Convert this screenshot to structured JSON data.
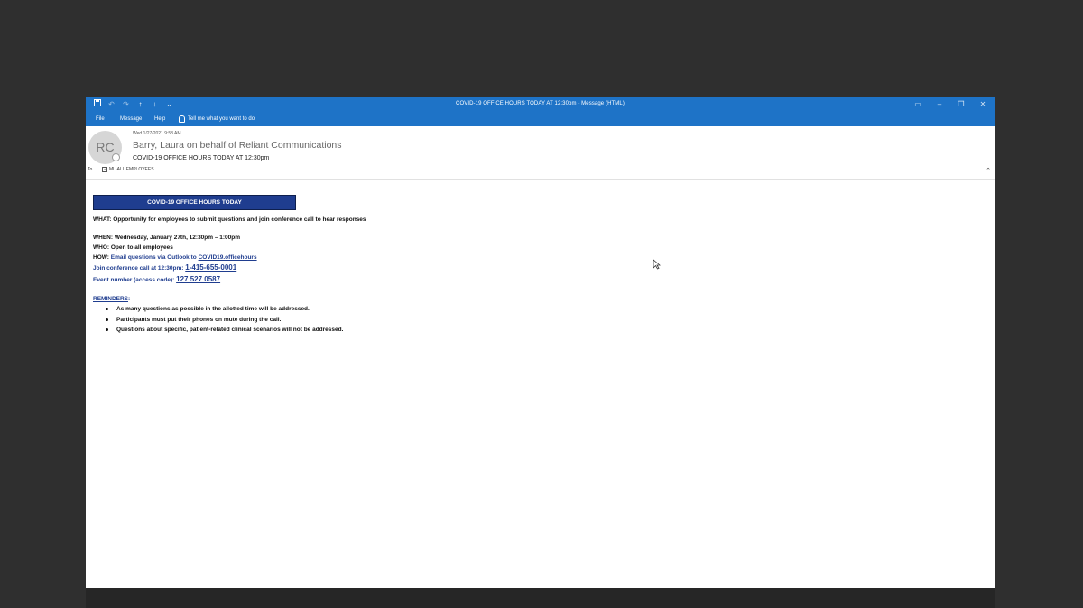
{
  "window": {
    "title": "COVID-19 OFFICE HOURS TODAY AT 12:30pm  -  Message (HTML)",
    "qat": [
      "save-icon",
      "undo-icon",
      "redo-icon",
      "up-arrow-icon",
      "down-arrow-icon",
      "customize-icon"
    ],
    "controls": [
      "ribbon-display-icon",
      "minimize-icon",
      "restore-icon",
      "close-icon"
    ]
  },
  "menu": {
    "items": [
      "File",
      "Message",
      "Help"
    ],
    "tell_me": "Tell me what you want to do"
  },
  "header": {
    "avatar_initials": "RC",
    "date": "Wed 1/27/2021 9:58 AM",
    "sender": "Barry, Laura on behalf of Reliant Communications",
    "subject": "COVID-19 OFFICE HOURS TODAY AT 12:30pm",
    "to_label": "To",
    "to_value": "ML-ALL EMPLOYEES"
  },
  "body": {
    "banner": "COVID-19 OFFICE HOURS TODAY",
    "what": "WHAT: Opportunity for employees to submit questions and join conference call to hear responses",
    "when": "WHEN: Wednesday, January 27th, 12:30pm – 1:00pm",
    "who": "WHO: Open to all employees",
    "how_label": "HOW:",
    "how_text": "Email questions via Outlook to",
    "how_link": "COVID19.officehours",
    "join_label": "Join conference call at 12:30pm:",
    "join_phone": "1-415-655-0001",
    "event_label": "Event number (access code):",
    "event_code": "127 527 0587",
    "reminders_title": "REMINDERS",
    "reminders_colon": ":",
    "reminders": [
      "As many questions as possible in the allotted time will be addressed.",
      "Participants must put their phones on mute during the call.",
      "Questions about specific, patient-related clinical scenarios will not be addressed."
    ]
  },
  "colors": {
    "titlebar": "#1e73c7",
    "banner": "#1f3d8f",
    "link": "#1f3d8f",
    "background": "#2f2f2f"
  }
}
